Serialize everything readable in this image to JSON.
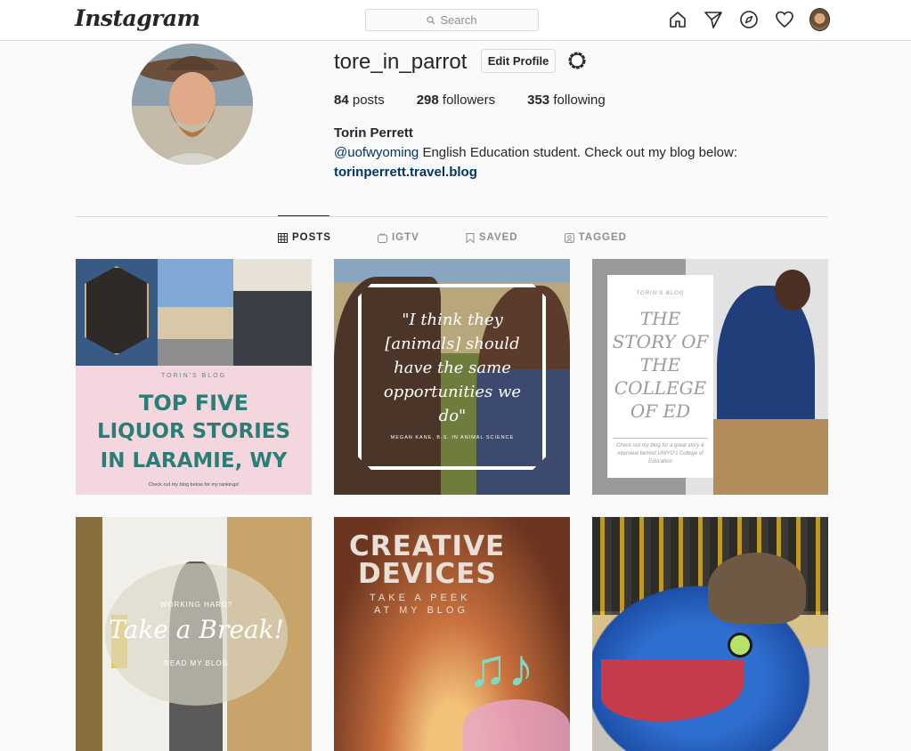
{
  "nav": {
    "logo": "Instagram",
    "search_placeholder": "Search",
    "icons": [
      "home-icon",
      "direct-icon",
      "explore-icon",
      "activity-heart-icon",
      "profile-avatar"
    ]
  },
  "profile": {
    "username": "tore_in_parrot",
    "edit_button": "Edit Profile",
    "stats": {
      "posts_count": "84",
      "posts_label": "posts",
      "followers_count": "298",
      "followers_label": "followers",
      "following_count": "353",
      "following_label": "following"
    },
    "full_name": "Torin Perrett",
    "bio_mention": "@uofwyoming",
    "bio_text": " English Education student. Check out my blog below:",
    "bio_link": "torinperrett.travel.blog"
  },
  "tabs": [
    {
      "label": "POSTS",
      "icon": "grid-icon",
      "active": true
    },
    {
      "label": "IGTV",
      "icon": "igtv-icon",
      "active": false
    },
    {
      "label": "SAVED",
      "icon": "bookmark-icon",
      "active": false
    },
    {
      "label": "TAGGED",
      "icon": "tagged-icon",
      "active": false
    }
  ],
  "posts": {
    "p1": {
      "blog": "TORIN'S BLOG",
      "line1": "TOP FIVE",
      "line2": "LIQUOR STORIES",
      "line3": "IN LARAMIE, WY",
      "footer": "Check out my blog below for my rankings!"
    },
    "p2": {
      "quote": "\"I think they [animals] should have the same opportunities we do\"",
      "caption": "MEGAN KANE, B.S. IN ANIMAL SCIENCE"
    },
    "p3": {
      "blog": "TORIN'S BLOG",
      "title": "THE STORY OF THE COLLEGE OF ED",
      "sub": "Check out my blog for a great story & interview behind UWYO's College of Education"
    },
    "p4": {
      "top": "WORKING HARD?",
      "main": "Take a Break!",
      "bottom": "READ MY BLOG"
    },
    "p5": {
      "line1": "CREATIVE",
      "line2": "DEVICES",
      "line3": "TAKE A PEEK",
      "line4": "AT MY BLOG"
    }
  },
  "colors": {
    "link": "#003569",
    "border": "#dbdbdb",
    "text": "#262626",
    "muted": "#8e8e8e"
  }
}
